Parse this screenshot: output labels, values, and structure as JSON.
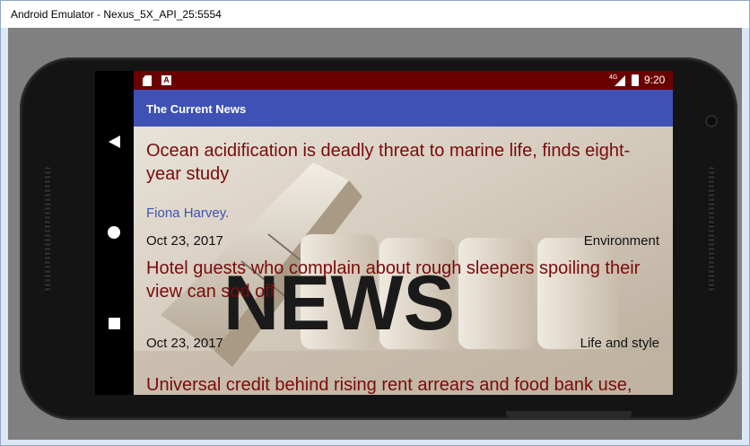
{
  "window": {
    "title": "Android Emulator - Nexus_5X_API_25:5554"
  },
  "statusbar": {
    "time": "9:20",
    "network": "4G",
    "icons": [
      "sd-card-icon",
      "a-notification-icon",
      "signal-icon",
      "battery-icon"
    ]
  },
  "navbar": {
    "icons": [
      "back-icon",
      "home-icon",
      "recents-icon"
    ]
  },
  "toolbar": {
    "title": "The Current News"
  },
  "articles": [
    {
      "title": "Ocean acidification is deadly threat to marine life, finds eight-year study",
      "author": "Fiona Harvey.",
      "date": "Oct 23, 2017",
      "section": "Environment"
    },
    {
      "title": "Hotel guests who complain about rough sleepers spoiling their view can sod off",
      "author": "",
      "date": "Oct 23, 2017",
      "section": "Life and style"
    },
    {
      "title": "Universal credit behind rising rent arrears and food bank use,",
      "author": "",
      "date": "",
      "section": ""
    }
  ],
  "background_image": {
    "text": "NEWS"
  },
  "colors": {
    "statusbar": "#6b0000",
    "toolbar": "#3f51b5",
    "title_text": "#7a0b0b",
    "author_text": "#3f51b5"
  }
}
